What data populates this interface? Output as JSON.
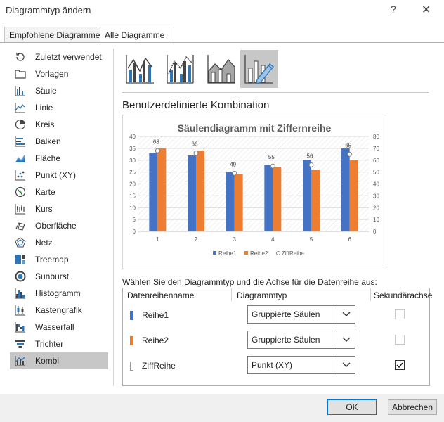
{
  "window": {
    "title": "Diagrammtyp ändern",
    "help": "?",
    "close": "✕"
  },
  "tabs": [
    {
      "label": "Empfohlene Diagramme"
    },
    {
      "label": "Alle Diagramme"
    }
  ],
  "sidebar": {
    "items": [
      {
        "label": "Zuletzt verwendet",
        "icon": "recent-icon"
      },
      {
        "label": "Vorlagen",
        "icon": "folder-icon"
      },
      {
        "label": "Säule",
        "icon": "column-chart-icon"
      },
      {
        "label": "Linie",
        "icon": "line-chart-icon"
      },
      {
        "label": "Kreis",
        "icon": "pie-chart-icon"
      },
      {
        "label": "Balken",
        "icon": "bar-chart-icon"
      },
      {
        "label": "Fläche",
        "icon": "area-chart-icon"
      },
      {
        "label": "Punkt (XY)",
        "icon": "scatter-chart-icon"
      },
      {
        "label": "Karte",
        "icon": "map-chart-icon"
      },
      {
        "label": "Kurs",
        "icon": "stock-chart-icon"
      },
      {
        "label": "Oberfläche",
        "icon": "surface-chart-icon"
      },
      {
        "label": "Netz",
        "icon": "radar-chart-icon"
      },
      {
        "label": "Treemap",
        "icon": "treemap-icon"
      },
      {
        "label": "Sunburst",
        "icon": "sunburst-icon"
      },
      {
        "label": "Histogramm",
        "icon": "histogram-icon"
      },
      {
        "label": "Kastengrafik",
        "icon": "box-whisker-icon"
      },
      {
        "label": "Wasserfall",
        "icon": "waterfall-icon"
      },
      {
        "label": "Trichter",
        "icon": "funnel-icon"
      },
      {
        "label": "Kombi",
        "icon": "combo-chart-icon",
        "selected": true
      }
    ]
  },
  "main": {
    "heading": "Benutzerdefinierte Kombination",
    "prompt": "Wählen Sie den Diagrammtyp und die Achse für die Datenreihe aus:",
    "variants": [
      {
        "icon": "combo-clustered-column-line-icon"
      },
      {
        "icon": "combo-column-line-secondary-icon"
      },
      {
        "icon": "combo-area-column-icon"
      },
      {
        "icon": "combo-custom-icon",
        "selected": true
      }
    ]
  },
  "chart_data": {
    "type": "bar",
    "title": "Säulendiagramm mit Ziffernreihe",
    "categories": [
      "1",
      "2",
      "3",
      "4",
      "5",
      "6"
    ],
    "series": [
      {
        "name": "Reihe1",
        "values": [
          33,
          32,
          25,
          28,
          30,
          35
        ],
        "color": "#4472c4"
      },
      {
        "name": "Reihe2",
        "values": [
          35,
          34,
          24,
          27,
          26,
          30
        ],
        "color": "#ed7d31"
      },
      {
        "name": "ZiffReihe",
        "type": "scatter",
        "axis": "secondary",
        "values": [
          68,
          66,
          49,
          55,
          56,
          65
        ],
        "labels": [
          "68",
          "66",
          "49",
          "55",
          "56",
          "65"
        ]
      }
    ],
    "yticks_primary": [
      "40",
      "35",
      "30",
      "25",
      "20",
      "15",
      "10",
      "5",
      "0"
    ],
    "yticks_secondary": [
      "80",
      "70",
      "60",
      "50",
      "40",
      "30",
      "20",
      "10",
      "0"
    ],
    "ylim": [
      0,
      40
    ],
    "y2lim": [
      0,
      80
    ],
    "grid": true,
    "legend": "bottom"
  },
  "series_table": {
    "headers": {
      "name": "Datenreihenname",
      "type": "Diagrammtyp",
      "secondary": "Sekundärachse"
    },
    "rows": [
      {
        "name": "Reihe1",
        "color": "#4472c4",
        "type": "Gruppierte Säulen",
        "secondary": false
      },
      {
        "name": "Reihe2",
        "color": "#ed7d31",
        "type": "Gruppierte Säulen",
        "secondary": false
      },
      {
        "name": "ZiffReihe",
        "color": "#ffffff",
        "type": "Punkt (XY)",
        "secondary": true
      }
    ]
  },
  "footer": {
    "ok": "OK",
    "cancel": "Abbrechen"
  }
}
